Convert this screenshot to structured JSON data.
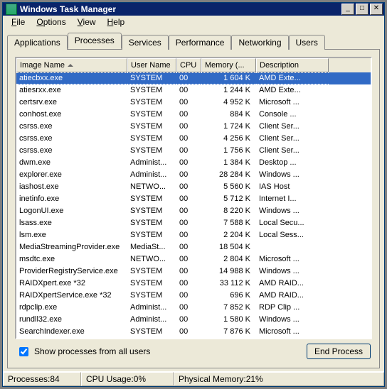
{
  "title": "Windows Task Manager",
  "menu": {
    "file": "File",
    "options": "Options",
    "view": "View",
    "help": "Help"
  },
  "tabs": {
    "applications": "Applications",
    "processes": "Processes",
    "services": "Services",
    "performance": "Performance",
    "networking": "Networking",
    "users": "Users"
  },
  "columns": {
    "image": "Image Name",
    "user": "User Name",
    "cpu": "CPU",
    "mem": "Memory (...",
    "desc": "Description"
  },
  "selected_index": 0,
  "processes": [
    {
      "image": "atiecbxx.exe",
      "user": "SYSTEM",
      "cpu": "00",
      "mem": "1 604 K",
      "desc": "AMD Exte..."
    },
    {
      "image": "atiesrxx.exe",
      "user": "SYSTEM",
      "cpu": "00",
      "mem": "1 244 K",
      "desc": "AMD Exte..."
    },
    {
      "image": "certsrv.exe",
      "user": "SYSTEM",
      "cpu": "00",
      "mem": "4 952 K",
      "desc": "Microsoft ..."
    },
    {
      "image": "conhost.exe",
      "user": "SYSTEM",
      "cpu": "00",
      "mem": "884 K",
      "desc": "Console ..."
    },
    {
      "image": "csrss.exe",
      "user": "SYSTEM",
      "cpu": "00",
      "mem": "1 724 K",
      "desc": "Client Ser..."
    },
    {
      "image": "csrss.exe",
      "user": "SYSTEM",
      "cpu": "00",
      "mem": "4 256 K",
      "desc": "Client Ser..."
    },
    {
      "image": "csrss.exe",
      "user": "SYSTEM",
      "cpu": "00",
      "mem": "1 756 K",
      "desc": "Client Ser..."
    },
    {
      "image": "dwm.exe",
      "user": "Administ...",
      "cpu": "00",
      "mem": "1 384 K",
      "desc": "Desktop ..."
    },
    {
      "image": "explorer.exe",
      "user": "Administ...",
      "cpu": "00",
      "mem": "28 284 K",
      "desc": "Windows ..."
    },
    {
      "image": "iashost.exe",
      "user": "NETWO...",
      "cpu": "00",
      "mem": "5 560 K",
      "desc": "IAS Host"
    },
    {
      "image": "inetinfo.exe",
      "user": "SYSTEM",
      "cpu": "00",
      "mem": "5 712 K",
      "desc": "Internet I..."
    },
    {
      "image": "LogonUI.exe",
      "user": "SYSTEM",
      "cpu": "00",
      "mem": "8 220 K",
      "desc": "Windows ..."
    },
    {
      "image": "lsass.exe",
      "user": "SYSTEM",
      "cpu": "00",
      "mem": "7 588 K",
      "desc": "Local Secu..."
    },
    {
      "image": "lsm.exe",
      "user": "SYSTEM",
      "cpu": "00",
      "mem": "2 204 K",
      "desc": "Local Sess..."
    },
    {
      "image": "MediaStreamingProvider.exe",
      "user": "MediaSt...",
      "cpu": "00",
      "mem": "18 504 K",
      "desc": ""
    },
    {
      "image": "msdtc.exe",
      "user": "NETWO...",
      "cpu": "00",
      "mem": "2 804 K",
      "desc": "Microsoft ..."
    },
    {
      "image": "ProviderRegistryService.exe",
      "user": "SYSTEM",
      "cpu": "00",
      "mem": "14 988 K",
      "desc": "Windows ..."
    },
    {
      "image": "RAIDXpert.exe *32",
      "user": "SYSTEM",
      "cpu": "00",
      "mem": "33 112 K",
      "desc": "AMD RAID..."
    },
    {
      "image": "RAIDXpertService.exe *32",
      "user": "SYSTEM",
      "cpu": "00",
      "mem": "696 K",
      "desc": "AMD RAID..."
    },
    {
      "image": "rdpclip.exe",
      "user": "Administ...",
      "cpu": "00",
      "mem": "7 852 K",
      "desc": "RDP Clip ..."
    },
    {
      "image": "rundll32.exe",
      "user": "Administ...",
      "cpu": "00",
      "mem": "1 580 K",
      "desc": "Windows ..."
    },
    {
      "image": "SearchIndexer.exe",
      "user": "SYSTEM",
      "cpu": "00",
      "mem": "7 876 K",
      "desc": "Microsoft ..."
    }
  ],
  "show_all_label": "Show processes from all users",
  "end_process_label": "End Process",
  "status": {
    "procs_label": "Processes: ",
    "procs_val": "84",
    "cpu_label": "CPU Usage: ",
    "cpu_val": "0%",
    "mem_label": "Physical Memory: ",
    "mem_val": "21%"
  }
}
